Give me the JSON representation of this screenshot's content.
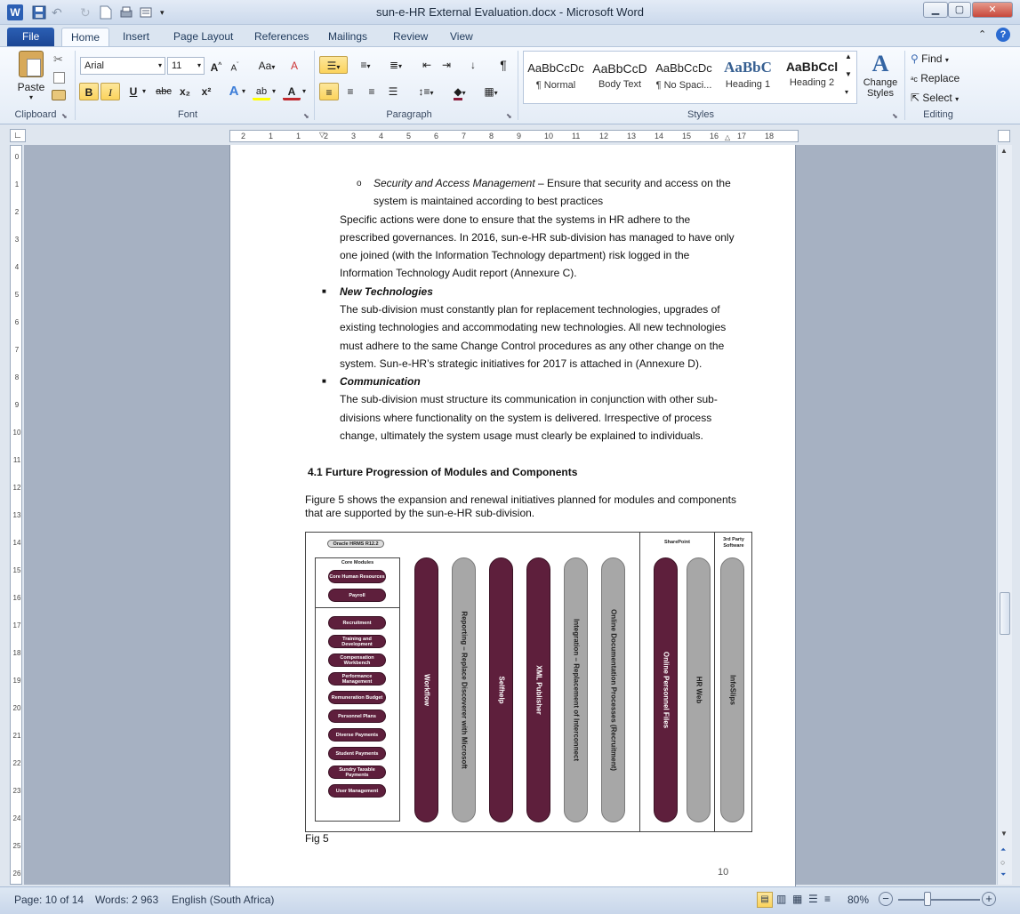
{
  "window": {
    "title": "sun-e-HR External Evaluation.docx - Microsoft Word",
    "buttons": {
      "minimize": "▁",
      "maximize": "▢",
      "close": "✕"
    }
  },
  "tabs": [
    {
      "label": "File"
    },
    {
      "label": "Home"
    },
    {
      "label": "Insert"
    },
    {
      "label": "Page Layout"
    },
    {
      "label": "References"
    },
    {
      "label": "Mailings"
    },
    {
      "label": "Review"
    },
    {
      "label": "View"
    }
  ],
  "ribbon": {
    "clipboard": {
      "paste": "Paste",
      "group": "Clipboard"
    },
    "font": {
      "name": "Arial",
      "size": "11",
      "group": "Font",
      "bold": "B",
      "italic": "I",
      "underline": "U",
      "strike": "abc",
      "sub": "x₂",
      "sup": "x²",
      "grow": "A",
      "shrink": "A",
      "case": "Aa"
    },
    "paragraph": {
      "group": "Paragraph",
      "pilcrow": "¶"
    },
    "styles": {
      "group": "Styles",
      "items": [
        {
          "preview": "AaBbCcDc",
          "name": "¶ Normal"
        },
        {
          "preview": "AaBbCcD",
          "name": "Body Text"
        },
        {
          "preview": "AaBbCcDc",
          "name": "¶ No Spaci..."
        },
        {
          "preview": "AaBbC",
          "name": "Heading 1"
        },
        {
          "preview": "AaBbCcl",
          "name": "Heading 2"
        }
      ],
      "change": "Change Styles"
    },
    "editing": {
      "group": "Editing",
      "find": "Find",
      "replace": "Replace",
      "select": "Select"
    }
  },
  "ruler": {
    "marks": [
      "2",
      "1",
      "1",
      "2",
      "3",
      "4",
      "5",
      "6",
      "7",
      "8",
      "9",
      "10",
      "11",
      "12",
      "13",
      "14",
      "15",
      "16",
      "17",
      "18"
    ]
  },
  "document": {
    "sub_bullet_title": "Security and Access Management",
    "sub_bullet_text1": " – Ensure that security and access on the",
    "sub_bullet_text2": "system is maintained according to best practices",
    "para1": [
      "Specific actions were done to ensure that the systems in HR adhere to the",
      "prescribed governances. In 2016, sun-e-HR sub-division has managed to have only",
      "one joined (with the Information Technology department) risk logged in the",
      "Information Technology Audit report (Annexure C)."
    ],
    "bullet1_title": "New Technologies",
    "para2": [
      "The sub-division must constantly plan for replacement technologies, upgrades of",
      "existing technologies and accommodating new technologies. All new technologies",
      "must adhere to the same Change Control procedures as any other change on the",
      "system. Sun-e-HR’s strategic initiatives for 2017 is attached in (Annexure D)."
    ],
    "bullet2_title": "Communication",
    "para3": [
      "The sub-division must structure its communication in conjunction with other sub-",
      "divisions where functionality on the system is delivered. Irrespective of process",
      "change, ultimately the system usage must clearly be explained to individuals."
    ],
    "heading": "4.1 Furture Progression of Modules and Components",
    "intro": [
      "Figure 5 shows the expansion and renewal initiatives planned for modules and components",
      "that are supported by the sun-e-HR sub-division."
    ],
    "caption": "Fig 5",
    "page_number": "10"
  },
  "figure": {
    "oracle_label": "Oracle HRMS R12.2",
    "core_label": "Core Modules",
    "core_modules": [
      "Core Human Resources",
      "Payroll"
    ],
    "modules": [
      "Recruitment",
      "Training and Development",
      "Compensation Workbench",
      "Performance Management",
      "Remuneration Budget",
      "Personnel Plans",
      "Diverse Payments",
      "Student Payments",
      "Sundry Taxable Payments",
      "User Management"
    ],
    "pillars": [
      {
        "label": "Workflow",
        "color": "maroon"
      },
      {
        "label": "Reporting – Replace Discoverer with Microsoft",
        "color": "grey"
      },
      {
        "label": "Selfhelp",
        "color": "maroon"
      },
      {
        "label": "XML Publisher",
        "color": "maroon"
      },
      {
        "label": "Integration – Replacement of Interconnect",
        "color": "grey"
      },
      {
        "label": "Online Documentation Processes (Recruitment)",
        "color": "grey"
      }
    ],
    "sharepoint_label": "SharePoint",
    "sharepoint_pillars": [
      {
        "label": "Online Personnel Files",
        "color": "maroon"
      },
      {
        "label": "HR Web",
        "color": "grey"
      }
    ],
    "third_party_label": "3rd Party Software",
    "third_party_pillars": [
      {
        "label": "InfoSlips",
        "color": "grey"
      }
    ],
    "colors": {
      "maroon": "#5e1f3c",
      "grey": "#a7a7a7"
    }
  },
  "status": {
    "page": "Page: 10 of 14",
    "words": "Words: 2 963",
    "language": "English (South Africa)",
    "zoom": "80%"
  }
}
